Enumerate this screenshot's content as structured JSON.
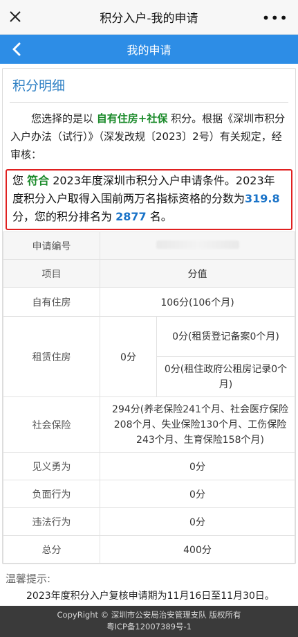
{
  "topbar": {
    "title": "积分入户-我的申请",
    "close_icon": "close-icon",
    "more_label": "•••"
  },
  "navbar": {
    "title": "我的申请",
    "back_icon": "chevron-left-icon"
  },
  "section": {
    "title": "积分明细"
  },
  "intro": {
    "part1": "您选择的是以 ",
    "option": "自有住房+社保",
    "part2": " 积分。根据《深圳市积分入户办法（试行）》（深发改规〔2023〕2号）有关规定，经审核："
  },
  "result": {
    "p1": "您 ",
    "status": "符合",
    "p2": " 2023年度深圳市积分入户申请条件。2023年度积分入户取得入围前两万名指标资格的分数为",
    "score": "319.8",
    "p3": "分，您的积分排名为 ",
    "rank": "2877",
    "p4": " 名。"
  },
  "table": {
    "app_no_label": "申请编号",
    "app_no_value": "",
    "header_item": "项目",
    "header_value": "分值",
    "own_house_label": "自有住房",
    "own_house_value": "106分(106个月)",
    "rental_label": "租赁住房",
    "rental_total": "0分",
    "rental_sub1": "0分(租赁登记备案0个月)",
    "rental_sub2": "0分(租住政府公租房记录0个月)",
    "social_label": "社会保险",
    "social_value": "294分(养老保险241个月、社会医疗保险208个月、失业保险130个月、工伤保险243个月、生育保险158个月)",
    "brave_label": "见义勇为",
    "brave_value": "0分",
    "negative_label": "负面行为",
    "negative_value": "0分",
    "illegal_label": "违法行为",
    "illegal_value": "0分",
    "total_label": "总分",
    "total_value": "400分"
  },
  "tips": {
    "title": "温馨提示:",
    "line1": "2023年度积分入户复核申请期为11月16日至11月30日。"
  },
  "footer": {
    "line1": "CopyRight © 深圳市公安局治安管理支队 版权所有",
    "line2": "粤ICP备12007389号-1"
  }
}
